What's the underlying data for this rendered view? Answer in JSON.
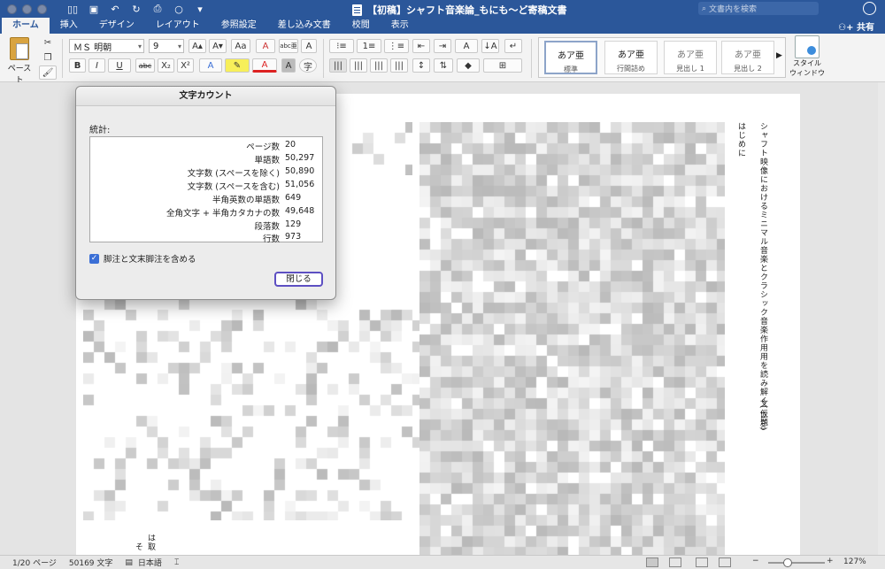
{
  "titlebar": {
    "doc_title": "【初稿】シャフト音楽論_もにも～ど寄稿文書",
    "search_placeholder": "文書内を検索"
  },
  "ribbon_tabs": [
    "ホーム",
    "挿入",
    "デザイン",
    "レイアウト",
    "参照設定",
    "差し込み文書",
    "校閲",
    "表示"
  ],
  "share_label": "共有",
  "ribbon": {
    "paste_label": "ペースト",
    "font_name": "ＭＳ 明朝",
    "font_size": "9",
    "styles": [
      {
        "sample": "あア亜",
        "name": "標準"
      },
      {
        "sample": "あア亜",
        "name": "行間詰め"
      },
      {
        "sample": "あア亜",
        "name": "見出し 1"
      },
      {
        "sample": "あア亜",
        "name": "見出し 2"
      }
    ],
    "style_pane_label_1": "スタイル",
    "style_pane_label_2": "ウィンドウ",
    "font_buttons": {
      "bold": "B",
      "italic": "I",
      "underline": "U",
      "strike": "abc",
      "sub": "X₂",
      "sup": "X²",
      "grow": "A▴",
      "shrink": "A▾",
      "case": "Aa",
      "clear": "A",
      "ruby": "abc亜",
      "border": "A",
      "effects": "A",
      "color": "A",
      "shade": "A",
      "enclose": "字"
    }
  },
  "document": {
    "heading": "シャフト映像におけるミニマル音楽とクラシック音楽作用用を読み解く(仮題)",
    "byline": "文 rino",
    "section": "はじめに",
    "fragment_1": "は取",
    "fragment_2": "そ"
  },
  "dialog": {
    "title": "文字カウント",
    "stats_label": "統計:",
    "rows": [
      {
        "label": "ページ数",
        "value": "20"
      },
      {
        "label": "単語数",
        "value": "50,297"
      },
      {
        "label": "文字数 (スペースを除く)",
        "value": "50,890"
      },
      {
        "label": "文字数 (スペースを含む)",
        "value": "51,056"
      },
      {
        "label": "半角英数の単語数",
        "value": "649"
      },
      {
        "label": "全角文字 + 半角カタカナの数",
        "value": "49,648"
      },
      {
        "label": "段落数",
        "value": "129"
      },
      {
        "label": "行数",
        "value": "973"
      }
    ],
    "checkbox_label": "脚注と文末脚注を含める",
    "checkbox_checked": true,
    "close_label": "閉じる"
  },
  "statusbar": {
    "page": "1/20 ページ",
    "words": "50169 文字",
    "language": "日本語",
    "zoom": "127%",
    "zoom_minus": "−",
    "zoom_plus": "+"
  }
}
